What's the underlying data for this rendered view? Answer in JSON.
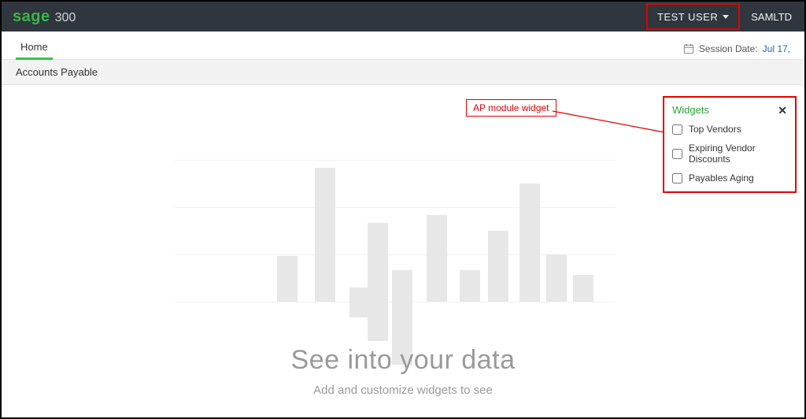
{
  "brand": {
    "name": "sage",
    "product": "300"
  },
  "topbar": {
    "user": "TEST USER",
    "company": "SAMLTD"
  },
  "tabs": {
    "home": "Home"
  },
  "session": {
    "label": "Session Date:",
    "date": "Jul 17,"
  },
  "module": {
    "current": "Accounts Payable"
  },
  "callout": {
    "label": "AP module widget"
  },
  "widgets": {
    "title": "Widgets",
    "items": [
      {
        "label": "Top Vendors"
      },
      {
        "label": "Expiring Vendor Discounts"
      },
      {
        "label": "Payables Aging"
      }
    ]
  },
  "headline": {
    "title": "See into your data",
    "subtitle": "Add and customize widgets to see"
  }
}
